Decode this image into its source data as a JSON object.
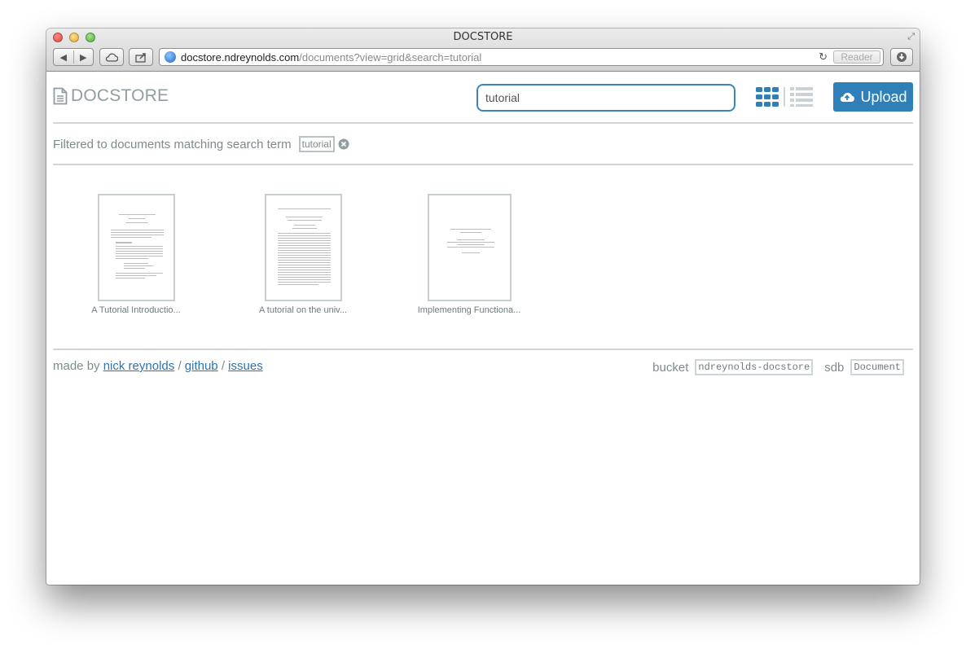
{
  "browser": {
    "window_title": "DOCSTORE",
    "url_host": "docstore.ndreynolds.com",
    "url_path": "/documents?view=grid&search=tutorial",
    "reader_label": "Reader"
  },
  "header": {
    "logo_text": "DOCSTORE",
    "search_value": "tutorial",
    "upload_label": "Upload",
    "accent_color": "#2f80b9"
  },
  "filter": {
    "prefix": "Filtered to documents matching search term",
    "term": "tutorial"
  },
  "documents": [
    {
      "title": "A Tutorial Introductio..."
    },
    {
      "title": "A tutorial on the univ..."
    },
    {
      "title": "Implementing Functiona..."
    }
  ],
  "footer": {
    "made_by": "made by",
    "author": "nick reynolds",
    "sep": "/",
    "github": "github",
    "issues": "issues",
    "bucket_label": "bucket",
    "bucket_value": "ndreynolds-docstore",
    "sdb_label": "sdb",
    "sdb_value": "Document"
  }
}
